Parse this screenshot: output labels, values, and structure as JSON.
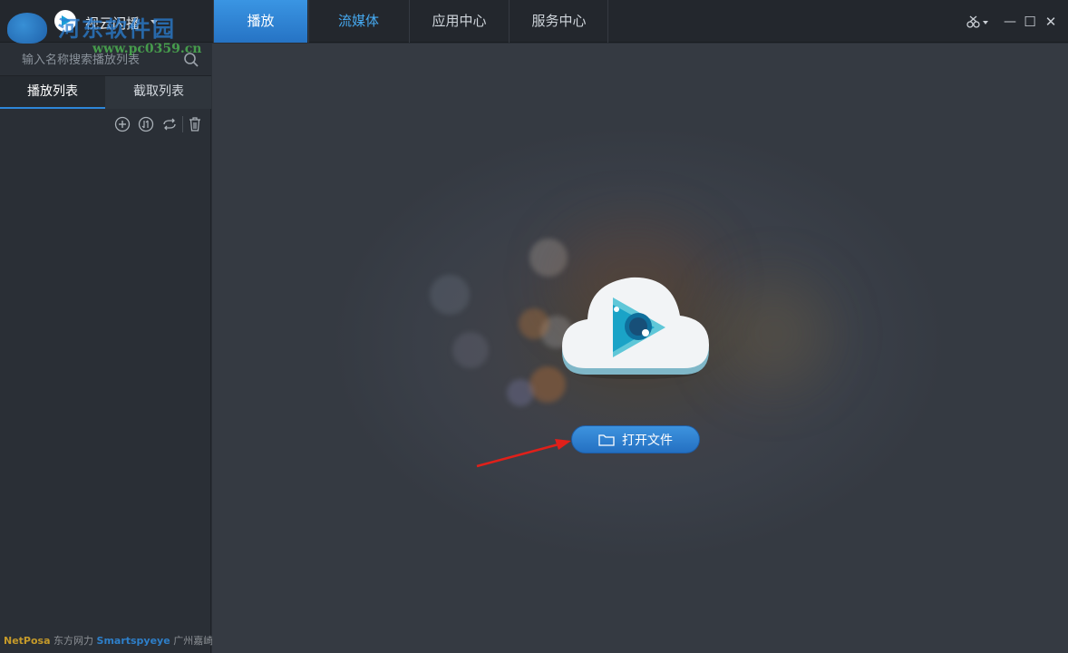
{
  "app": {
    "name": "视云闪播"
  },
  "watermark": {
    "text": "河东软件园",
    "url": "www.pc0359.cn"
  },
  "nav": {
    "tabs": [
      {
        "label": "播放"
      },
      {
        "label": "流媒体"
      },
      {
        "label": "应用中心"
      },
      {
        "label": "服务中心"
      }
    ]
  },
  "window": {
    "minimize": "—",
    "maximize": "☐",
    "close": "✕"
  },
  "sidebar": {
    "search_placeholder": "输入名称搜索播放列表",
    "tabs": [
      {
        "label": "播放列表"
      },
      {
        "label": "截取列表"
      }
    ]
  },
  "footer": {
    "brand1": "NetPosa",
    "brand1_cn": "东方网力",
    "brand2": "Smartspyeye",
    "brand2_cn": "广州嘉崎"
  },
  "main": {
    "open_file_label": "打开文件"
  },
  "colors": {
    "accent": "#2d86d8",
    "active_tab": "#2f7fd0",
    "arrow": "#e0201a"
  }
}
